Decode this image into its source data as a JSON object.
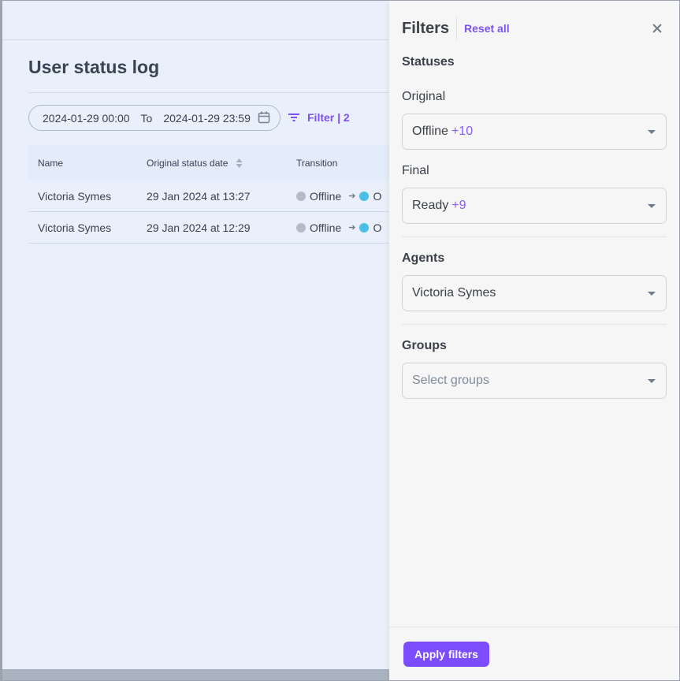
{
  "page": {
    "title": "User status log"
  },
  "date_range": {
    "from": "2024-01-29 00:00",
    "to_label": "To",
    "to": "2024-01-29 23:59"
  },
  "filter_button": {
    "label": "Filter | 2"
  },
  "table": {
    "columns": [
      "Name",
      "Original status date",
      "Transition"
    ],
    "rows": [
      {
        "name": "Victoria Symes",
        "date": "29 Jan 2024 at 13:27",
        "from_status": "Offline",
        "to_status": "O"
      },
      {
        "name": "Victoria Symes",
        "date": "29 Jan 2024 at 12:29",
        "from_status": "Offline",
        "to_status": "O"
      }
    ]
  },
  "drawer": {
    "title": "Filters",
    "reset_label": "Reset all",
    "statuses": {
      "title": "Statuses",
      "original": {
        "label": "Original",
        "value": "Offline",
        "extra": "+10"
      },
      "final": {
        "label": "Final",
        "value": "Ready",
        "extra": "+9"
      }
    },
    "agents": {
      "title": "Agents",
      "value": "Victoria Symes"
    },
    "groups": {
      "title": "Groups",
      "placeholder": "Select groups"
    },
    "apply_label": "Apply filters"
  },
  "colors": {
    "accent": "#7c4dff",
    "offline": "#b4bcc8",
    "online": "#4cbfe8"
  }
}
